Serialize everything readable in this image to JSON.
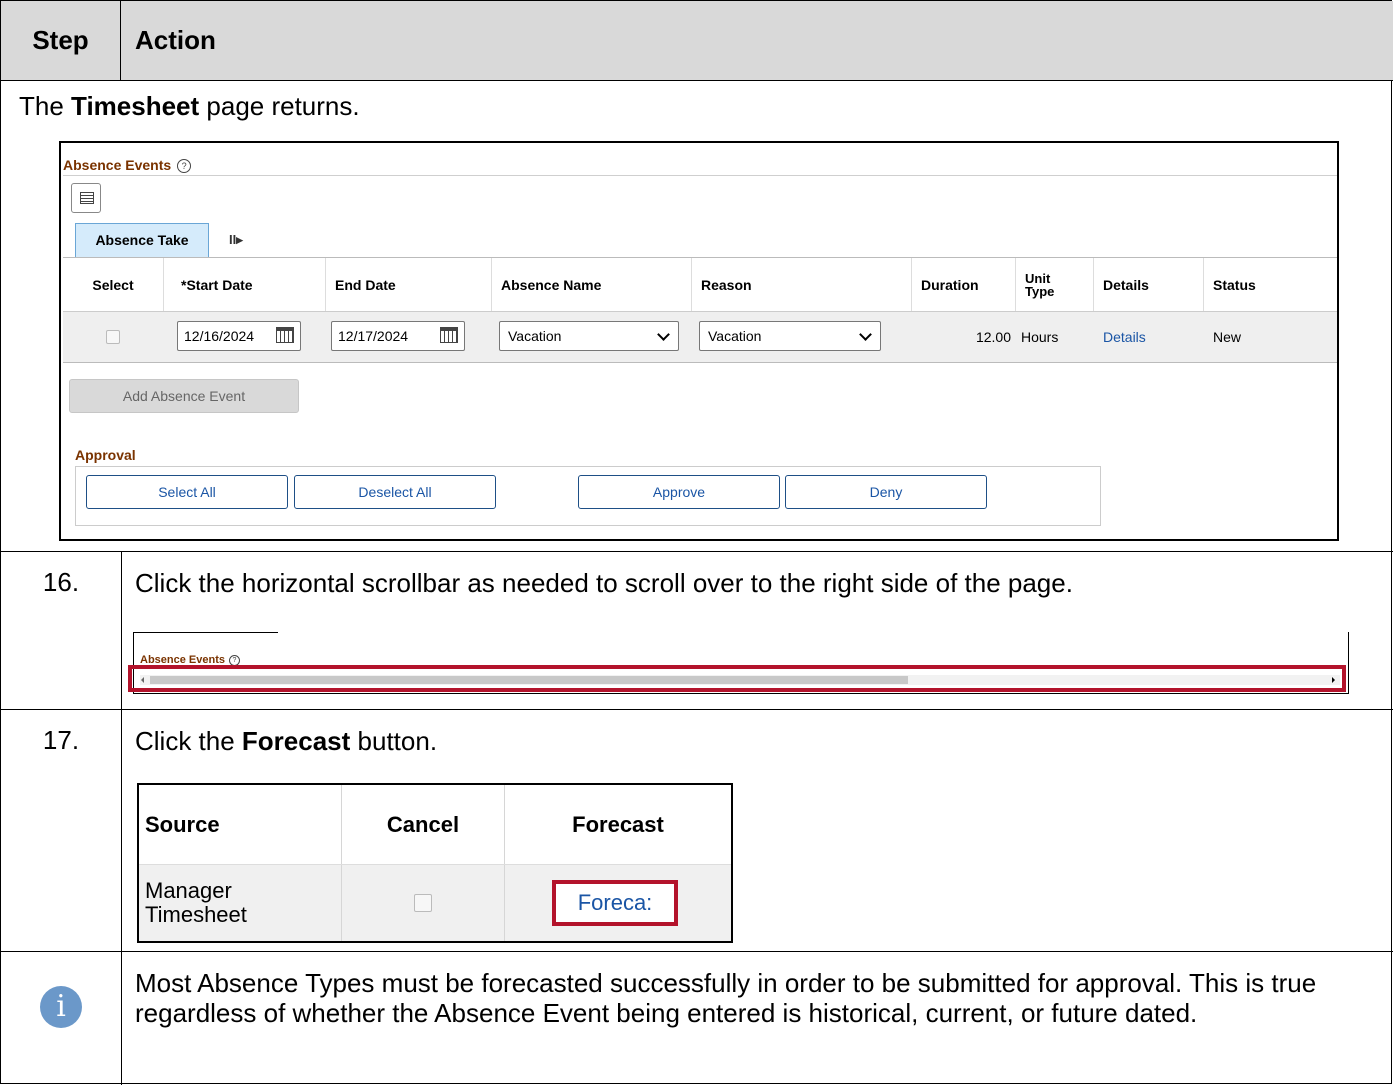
{
  "header": {
    "step": "Step",
    "action": "Action"
  },
  "intro": {
    "pre": "The ",
    "bold": "Timesheet",
    "post": " page returns."
  },
  "screenshot1": {
    "section_title": "Absence Events",
    "help_glyph": "?",
    "tab_label": "Absence Take",
    "tab_more": "II▸",
    "columns": {
      "select": "Select",
      "start_date": "*Start Date",
      "end_date": "End Date",
      "absence_name": "Absence Name",
      "reason": "Reason",
      "duration": "Duration",
      "unit_type_1": "Unit",
      "unit_type_2": "Type",
      "details": "Details",
      "status": "Status"
    },
    "row": {
      "start_date": "12/16/2024",
      "end_date": "12/17/2024",
      "absence_name": "Vacation",
      "reason": "Vacation",
      "duration": "12.00",
      "unit_type": "Hours",
      "details": "Details",
      "status": "New"
    },
    "add_button": "Add Absence Event",
    "approval_title": "Approval",
    "approval_buttons": {
      "select_all": "Select All",
      "deselect_all": "Deselect All",
      "approve": "Approve",
      "deny": "Deny"
    }
  },
  "step16": {
    "number": "16.",
    "text": "Click the horizontal scrollbar as needed to scroll over to the right side of the page.",
    "section_title": "Absence Events",
    "help_glyph": "?"
  },
  "step17": {
    "number": "17.",
    "text_pre": "Click the ",
    "text_bold": "Forecast",
    "text_post": " button.",
    "columns": {
      "source": "Source",
      "cancel": "Cancel",
      "forecast": "Forecast"
    },
    "row": {
      "source_1": "Manager",
      "source_2": "Timesheet",
      "forecast_button": "Foreca:"
    }
  },
  "note": {
    "icon": "i",
    "text": "Most Absence Types must be forecasted successfully in order to be submitted for approval. This is true regardless of whether the Absence Event being entered is historical, current, or future dated."
  },
  "colors": {
    "highlight": "#b3132b",
    "link": "#1a55a5",
    "section_title": "#7a3300",
    "header_bg": "#d9d9d9"
  }
}
